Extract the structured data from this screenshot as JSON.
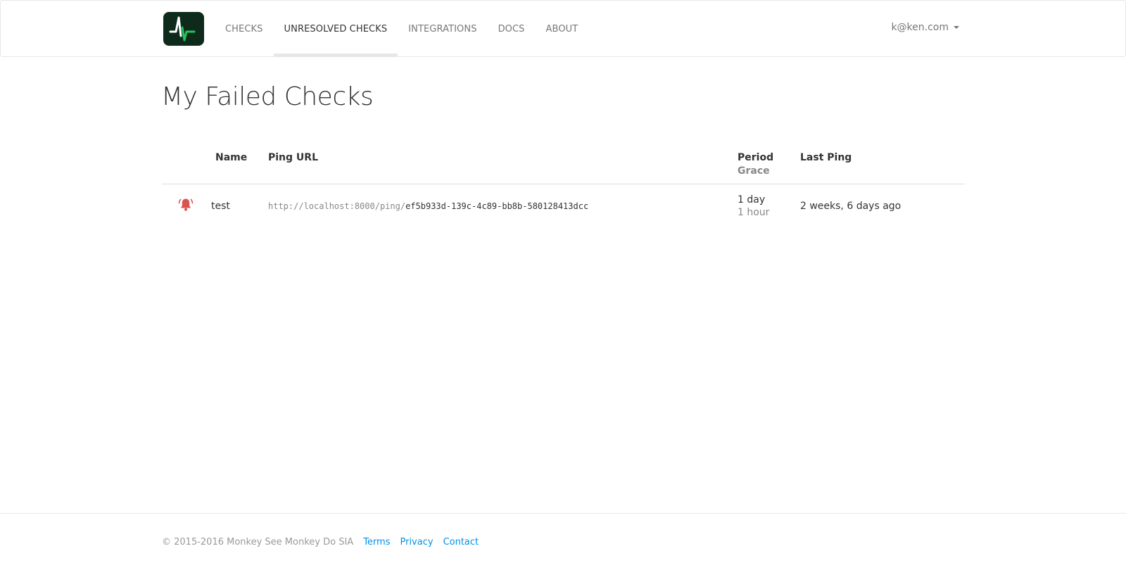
{
  "navbar": {
    "items": [
      {
        "label": "CHECKS",
        "active": false
      },
      {
        "label": "UNRESOLVED CHECKS",
        "active": true
      },
      {
        "label": "INTEGRATIONS",
        "active": false
      },
      {
        "label": "DOCS",
        "active": false
      },
      {
        "label": "ABOUT",
        "active": false
      }
    ],
    "user": "k@ken.com",
    "logo_colors": {
      "background": "#0d2a1a",
      "white_line": "#ffffff",
      "green_line": "#22c55e"
    }
  },
  "main": {
    "title": "My Failed Checks",
    "table": {
      "headers": {
        "name": "Name",
        "ping_url": "Ping URL",
        "period": "Period",
        "grace": "Grace",
        "last_ping": "Last Ping"
      },
      "rows": [
        {
          "status_icon": "bell-icon",
          "status_color": "#d9534f",
          "name": "test",
          "url_base": "http://localhost:8000/ping/",
          "url_code": "ef5b933d-139c-4c89-bb8b-580128413dcc",
          "period": "1 day",
          "grace": "1 hour",
          "last_ping": "2 weeks, 6 days ago"
        }
      ]
    }
  },
  "footer": {
    "copyright": "© 2015-2016 Monkey See Monkey Do SIA",
    "links": [
      "Terms",
      "Privacy",
      "Contact"
    ],
    "link_color": "#0091ea"
  }
}
